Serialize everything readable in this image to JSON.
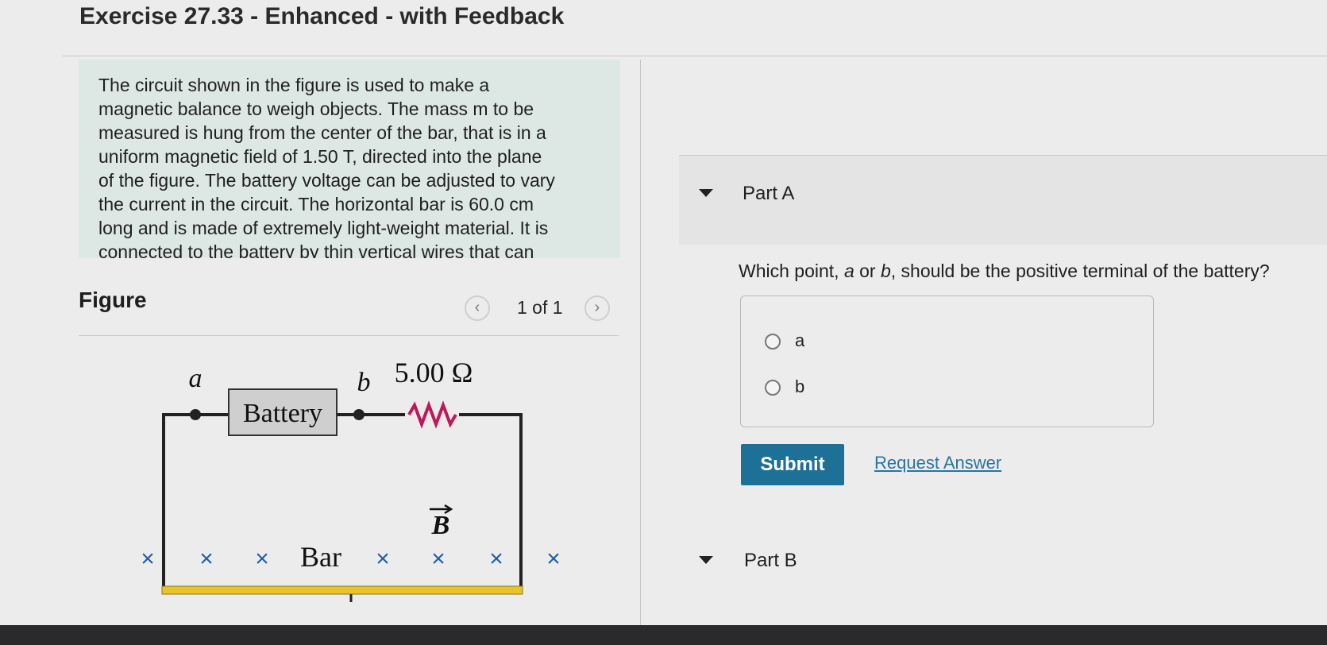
{
  "header": {
    "title": "Exercise 27.33 - Enhanced - with Feedback"
  },
  "problem": {
    "lines": [
      "The circuit shown in the figure is used to make a",
      "magnetic balance to weigh objects. The mass m to be",
      "measured is hung from the center of the bar, that is in a",
      "uniform magnetic field of 1.50 T, directed into the plane",
      "of the figure. The battery voltage can be adjusted to vary",
      "the current in the circuit. The horizontal bar is 60.0 cm",
      "long and is made of extremely light-weight material. It is",
      "connected to the battery by thin vertical wires that can"
    ]
  },
  "figure": {
    "label": "Figure",
    "page_counter": "1 of 1",
    "prev_icon": "chevron-left-icon",
    "next_icon": "chevron-right-icon",
    "circuit": {
      "point_a": "a",
      "point_b": "b",
      "battery_label": "Battery",
      "resistance": "5.00 Ω",
      "field_label": "B",
      "bar_label": "Bar",
      "field_symbol": "×"
    }
  },
  "partA": {
    "label": "Part A",
    "question_prefix": "Which point, ",
    "question_a": "a",
    "question_mid": " or ",
    "question_b": "b",
    "question_suffix": ", should be the positive terminal of the battery?",
    "options": [
      "a",
      "b"
    ],
    "submit_label": "Submit",
    "request_answer_label": "Request Answer"
  },
  "partB": {
    "label": "Part B"
  },
  "colors": {
    "problem_bg": "#dde7e4",
    "submit_bg": "#1d7196",
    "link": "#2a74a0",
    "resistor": "#c0175a",
    "field_x": "#1f5fa8",
    "bar": "#e8c32a"
  }
}
